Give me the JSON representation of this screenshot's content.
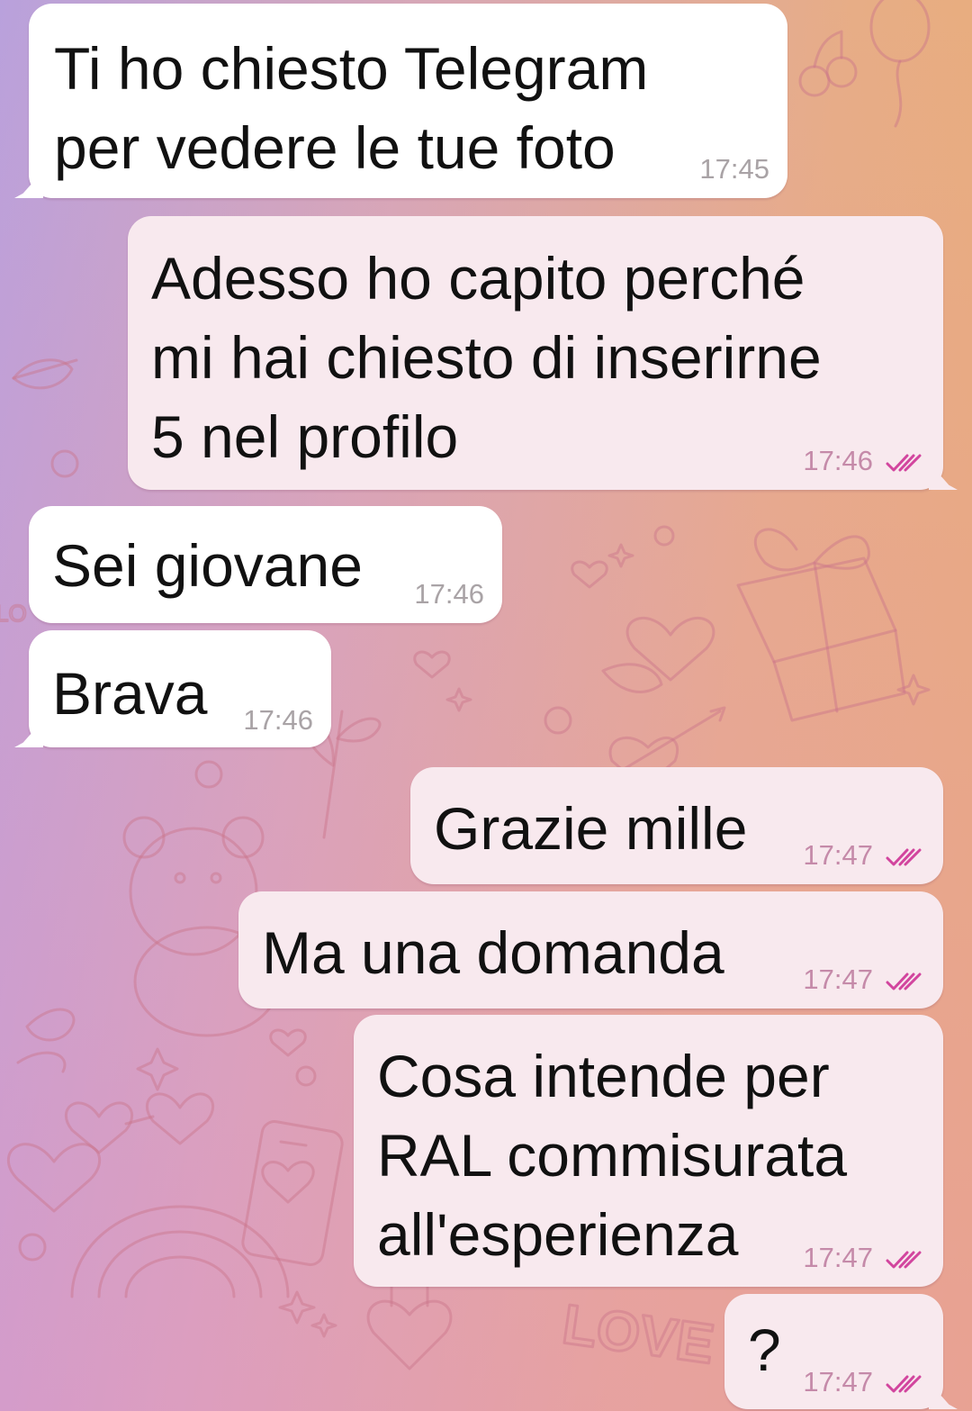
{
  "theme": {
    "incoming_bubble": "#ffffff",
    "outgoing_bubble": "#f8e9ee",
    "read_check_color": "#d2459e",
    "time_in_color": "#a9a3a6",
    "time_out_color": "#c58aa9",
    "doodle_color": "#c9738a"
  },
  "wallpaper": {
    "doodle_text": [
      "LOVE",
      "LO"
    ]
  },
  "messages": [
    {
      "direction": "in",
      "text": "Ti ho chiesto Telegram\nper vedere le tue foto",
      "time": "17:45"
    },
    {
      "direction": "out",
      "text": "Adesso ho capito perché\nmi hai chiesto di inserirne\n5 nel profilo",
      "time": "17:46",
      "status_icon": "double-check-icon"
    },
    {
      "direction": "in",
      "text": "Sei giovane",
      "time": "17:46"
    },
    {
      "direction": "in",
      "text": "Brava",
      "time": "17:46"
    },
    {
      "direction": "out",
      "text": "Grazie mille",
      "time": "17:47",
      "status_icon": "double-check-icon"
    },
    {
      "direction": "out",
      "text": "Ma una domanda",
      "time": "17:47",
      "status_icon": "double-check-icon"
    },
    {
      "direction": "out",
      "text": "Cosa intende per\nRAL commisurata\nall'esperienza",
      "time": "17:47",
      "status_icon": "double-check-icon"
    },
    {
      "direction": "out",
      "text": "?",
      "time": "17:47",
      "status_icon": "double-check-icon"
    }
  ]
}
